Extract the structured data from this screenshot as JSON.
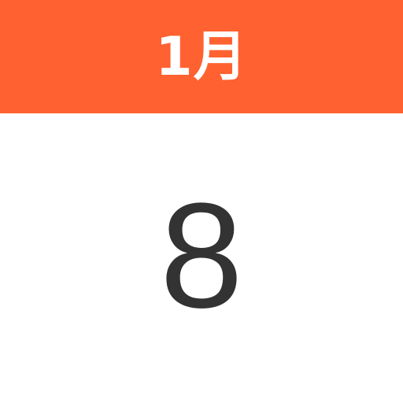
{
  "calendar": {
    "month_label": "1月",
    "day_number": "8"
  },
  "colors": {
    "header_background": "#ff6131",
    "month_text": "#ffffff",
    "day_text": "#333333",
    "body_background": "#ffffff"
  }
}
